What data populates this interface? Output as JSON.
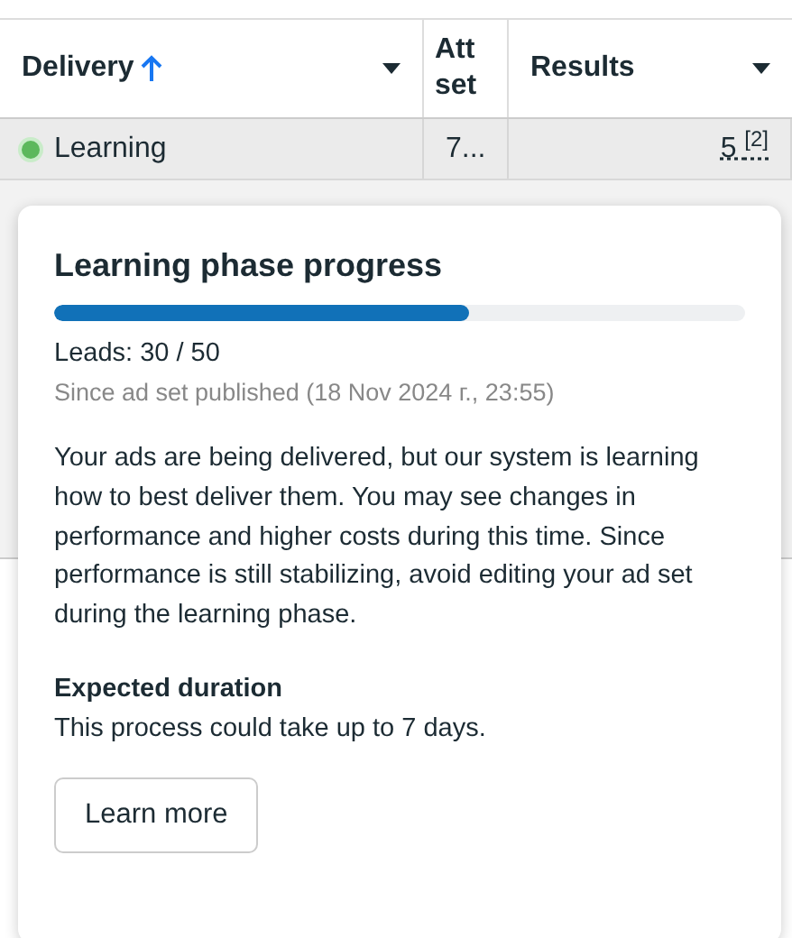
{
  "table": {
    "columns": [
      {
        "label": "Delivery",
        "sorted": true,
        "menu": true
      },
      {
        "label": "Att set",
        "sorted": false,
        "menu": false
      },
      {
        "label": "Results",
        "sorted": false,
        "menu": true
      }
    ],
    "rows": [
      {
        "status": "Learning",
        "color": "#5cb85c",
        "column_2": "7...",
        "results": "5 $^{[2]}$"
      }
    ]
  },
  "popover": {
    "title": "Learning phase progress",
    "progress": {
      "level": 0.6
    },
    "count": "Leads: 30 / 50",
    "since": "Since ad set published (18 Nov 2024 г., 23:55)",
    "body": "Your ads are being delivered, but our system is learning how to best deliver them. You may see changes in performance and higher costs during this time. Since performance is still stabilizing, avoid editing your ad set during the learning phase.",
    "duration_title": "Expected duration",
    "duration_text": "This process could take up to 7 days.",
    "button": "Learn more"
  }
}
